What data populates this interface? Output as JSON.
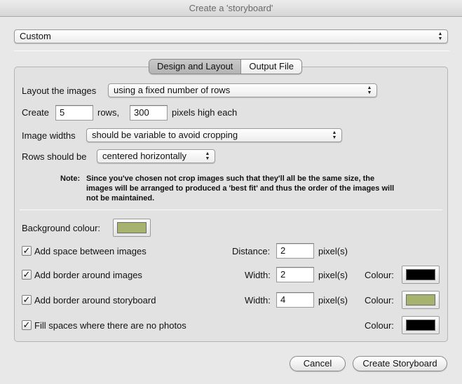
{
  "window": {
    "title": "Create a 'storyboard'"
  },
  "preset": {
    "value": "Custom"
  },
  "tabs": [
    {
      "label": "Design and Layout",
      "selected": true
    },
    {
      "label": "Output File",
      "selected": false
    }
  ],
  "layout": {
    "layout_label": "Layout the images",
    "layout_value": "using a fixed number of rows",
    "create_label": "Create",
    "rows_value": "5",
    "rows_label": "rows,",
    "height_value": "300",
    "height_label": "pixels high each",
    "widths_label": "Image widths",
    "widths_value": "should be variable to avoid cropping",
    "rows_should_label": "Rows should be",
    "rows_should_value": "centered horizontally"
  },
  "note": {
    "head": "Note:",
    "body": "Since you've chosen not crop images such that they'll all be the same size, the images will be arranged to produced a 'best fit' and thus the order of the images will not be maintained."
  },
  "background": {
    "label": "Background colour:",
    "color": "#a6b36f"
  },
  "options": [
    {
      "label": "Add space between images",
      "checked": true,
      "param_label": "Distance:",
      "param_value": "2",
      "unit": "pixel(s)"
    },
    {
      "label": "Add border around images",
      "checked": true,
      "param_label": "Width:",
      "param_value": "2",
      "unit": "pixel(s)",
      "colour_label": "Colour:",
      "color": "#000000"
    },
    {
      "label": "Add border around storyboard",
      "checked": true,
      "param_label": "Width:",
      "param_value": "4",
      "unit": "pixel(s)",
      "colour_label": "Colour:",
      "color": "#a6b36f"
    },
    {
      "label": "Fill spaces where there are no photos",
      "checked": true,
      "colour_label": "Colour:",
      "color": "#000000"
    }
  ],
  "checkmark": "✓",
  "buttons": {
    "cancel": "Cancel",
    "create": "Create Storyboard"
  }
}
